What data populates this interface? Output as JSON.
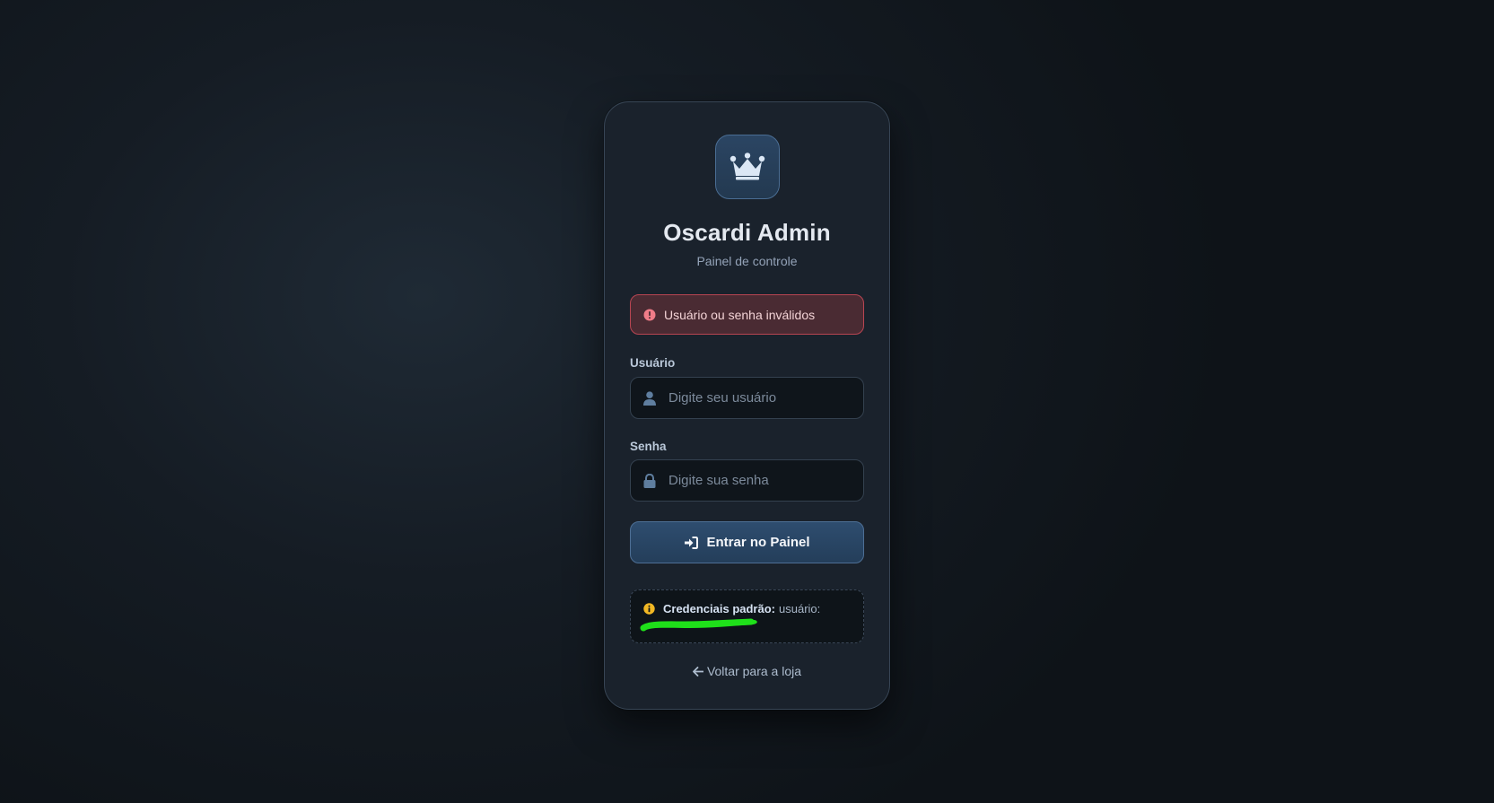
{
  "brand": {
    "logo_icon": "crown-icon",
    "title": "Oscardi Admin",
    "subtitle": "Painel de controle"
  },
  "alert": {
    "icon": "exclamation-circle-icon",
    "message": "Usuário ou senha inválidos",
    "color": "#b84552"
  },
  "form": {
    "username": {
      "label": "Usuário",
      "placeholder": "Digite seu usuário",
      "value": "",
      "icon": "user-icon"
    },
    "password": {
      "label": "Senha",
      "placeholder": "Digite sua senha",
      "value": "",
      "icon": "lock-icon"
    },
    "submit": {
      "label": "Entrar no Painel",
      "icon": "sign-in-icon"
    }
  },
  "credentials_hint": {
    "icon": "info-circle-icon",
    "strong": "Credenciais padrão:",
    "text": "usuário:"
  },
  "back_link": {
    "icon": "arrow-left-icon",
    "label": "Voltar para a loja"
  },
  "colors": {
    "accent": "#2e4d6f",
    "redaction": "#1fe01a",
    "info_icon": "#f2b824"
  }
}
